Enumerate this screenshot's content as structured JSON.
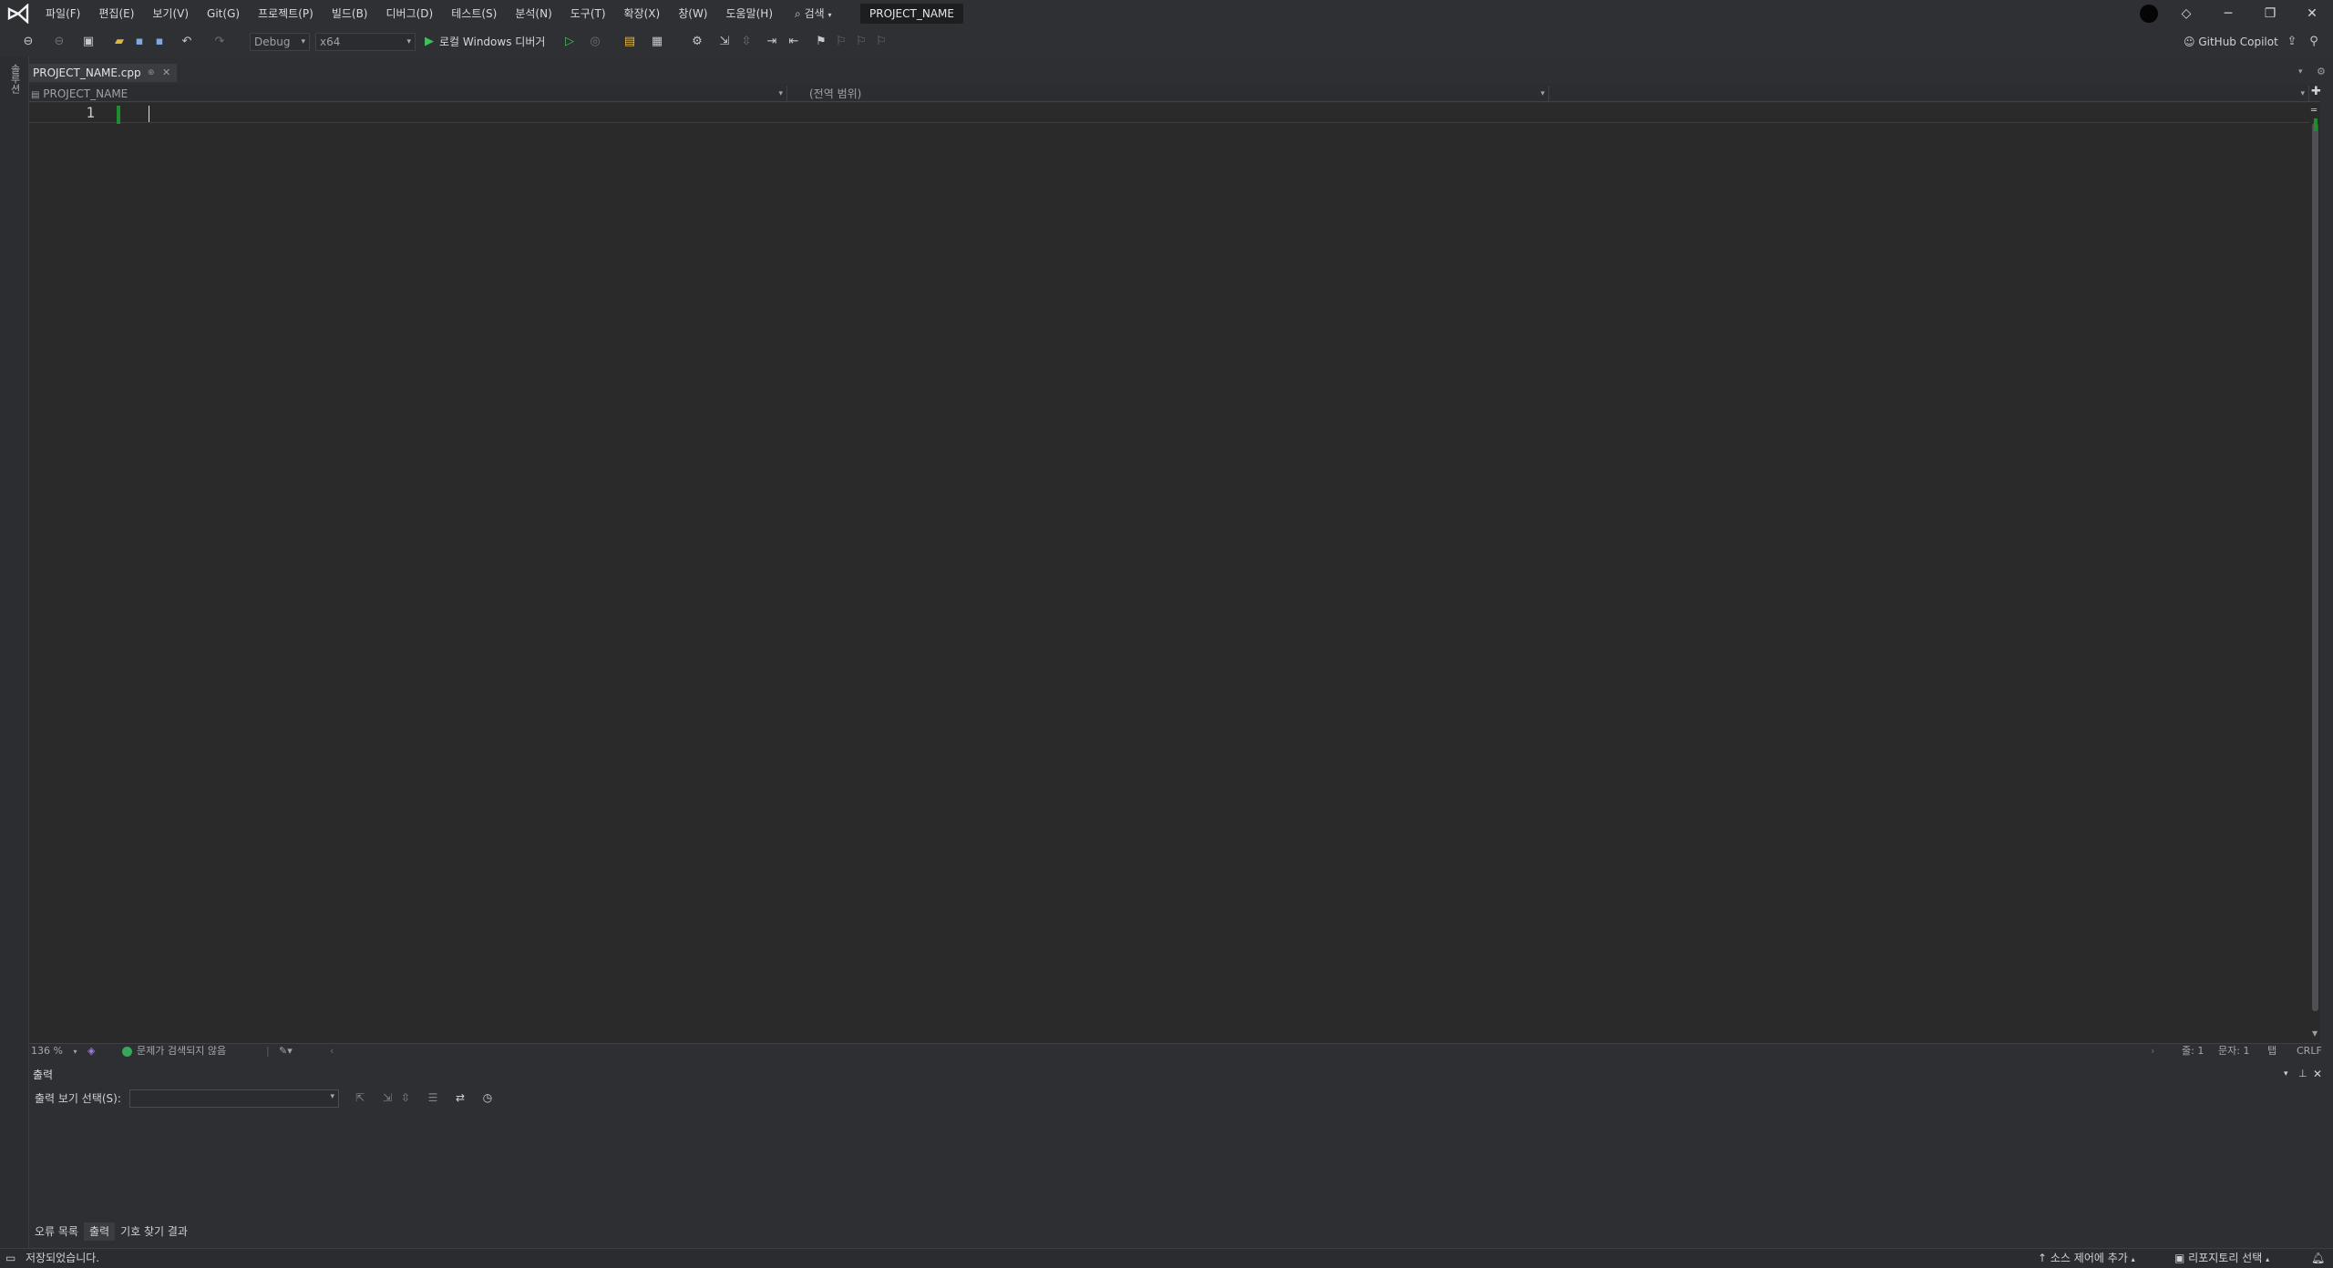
{
  "menu": [
    "파일(F)",
    "편집(E)",
    "보기(V)",
    "Git(G)",
    "프로젝트(P)",
    "빌드(B)",
    "디버그(D)",
    "테스트(S)",
    "분석(N)",
    "도구(T)",
    "확장(X)",
    "창(W)",
    "도움말(H)"
  ],
  "search": {
    "label": "검색"
  },
  "project_badge": "PROJECT_NAME",
  "window_controls": {
    "minimize": "─",
    "restore": "❐",
    "close": "✕"
  },
  "toolbar": {
    "config": "Debug",
    "platform": "x64",
    "run_label": "로컬 Windows 디버거",
    "copilot": "GitHub Copilot"
  },
  "left_strip_label": "솔루션",
  "tab": {
    "title": "PROJECT_NAME.cpp",
    "pin": "⊕",
    "close": "✕"
  },
  "navbar": {
    "project": "PROJECT_NAME",
    "scope": "(전역 범위)",
    "member": ""
  },
  "editor": {
    "line_numbers": [
      "1"
    ]
  },
  "editor_status": {
    "zoom": "136 %",
    "issues": "문제가 검색되지 않음",
    "line": "줄: 1",
    "char": "문자: 1",
    "indent": "탭",
    "eol": "CRLF"
  },
  "output": {
    "header": "출력",
    "select_label": "출력 보기 선택(S):",
    "select_value": ""
  },
  "bottom_tabs": [
    "오류 목록",
    "출력",
    "기호 찾기 결과"
  ],
  "statusbar": {
    "message": "저장되었습니다.",
    "source_control": "소스 제어에 추가",
    "repository": "리포지토리 선택"
  },
  "colors": {
    "accent_green": "#1f8c2e",
    "ok_green": "#3aa55c",
    "editor_bg": "#2a2a2a"
  },
  "icons": [
    "vs-logo-icon",
    "search-icon",
    "play-icon",
    "bell-icon"
  ]
}
